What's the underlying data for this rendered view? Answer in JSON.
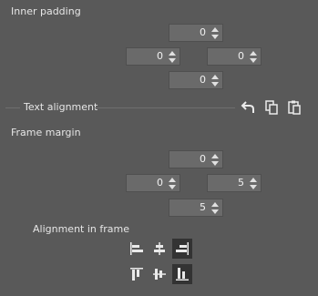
{
  "inner_padding": {
    "title": "Inner padding",
    "top": "0",
    "left": "0",
    "right": "0",
    "bottom": "0"
  },
  "text_alignment": {
    "title": "Text alignment",
    "icons": [
      "undo-icon",
      "copy-icon",
      "paste-icon"
    ]
  },
  "frame_margin": {
    "title": "Frame margin",
    "top": "0",
    "left": "0",
    "right": "5",
    "bottom": "5"
  },
  "alignment_in_frame": {
    "title": "Alignment in frame",
    "horizontal": [
      "align-left-icon",
      "align-center-h-icon",
      "align-right-icon"
    ],
    "vertical": [
      "align-top-icon",
      "align-center-v-icon",
      "align-bottom-icon"
    ],
    "active_horizontal": "align-right-icon",
    "active_vertical": "align-bottom-icon"
  }
}
